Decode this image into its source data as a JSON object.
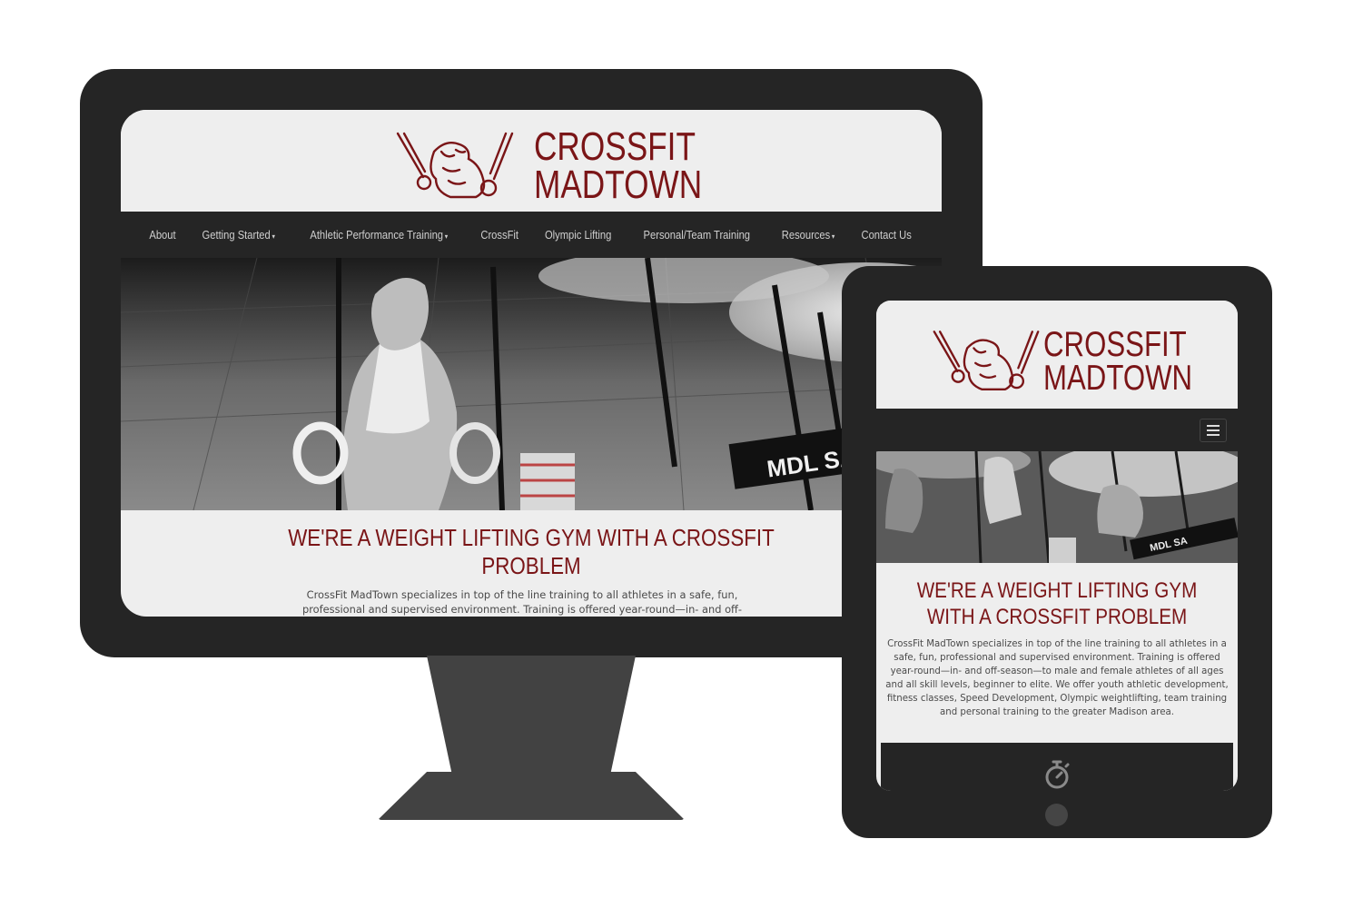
{
  "brand": {
    "line1": "CROSSFIT",
    "line2": "MADTOWN",
    "color": "#7a1517"
  },
  "nav": {
    "items": [
      {
        "label": "About",
        "has_dropdown": false
      },
      {
        "label": "Getting Started",
        "has_dropdown": true
      },
      {
        "label": "Athletic Performance Training",
        "has_dropdown": true
      },
      {
        "label": "CrossFit",
        "has_dropdown": false
      },
      {
        "label": "Olympic Lifting",
        "has_dropdown": false
      },
      {
        "label": "Personal/Team Training",
        "has_dropdown": false
      },
      {
        "label": "Resources",
        "has_dropdown": true
      },
      {
        "label": "Contact Us",
        "has_dropdown": false
      }
    ],
    "caret": "▾",
    "menu_icon": "hamburger-menu-icon"
  },
  "hero": {
    "desktop_banner_text": "MDL SA",
    "tablet_banner_text": "MDL SA"
  },
  "main": {
    "headline": "WE'RE A WEIGHT LIFTING GYM WITH A CROSSFIT PROBLEM",
    "desktop_body": "CrossFit MadTown specializes in top of the line training to all athletes in a safe, fun, professional and supervised environment. Training is offered year-round—in- and off-season—to male and female athletes of all ages and all skill levels, beginner to elite. We offer youth athletic development, fitness classes, Speed Development, Olympic weightlifting, team training and",
    "tablet_body": "CrossFit MadTown specializes in top of the line training to all athletes in a safe, fun, professional and supervised environment. Training is offered year-round—in- and off-season—to male and female athletes of all ages and all skill levels, beginner to elite. We offer youth athletic development, fitness classes, Speed Development, Olympic weightlifting, team training and personal training to the greater Madison area."
  },
  "feature": {
    "icon": "stopwatch-icon"
  },
  "colors": {
    "device_bezel": "#252525",
    "navbar": "#252525",
    "page_bg": "#eeeeee",
    "stand": "#424242"
  }
}
